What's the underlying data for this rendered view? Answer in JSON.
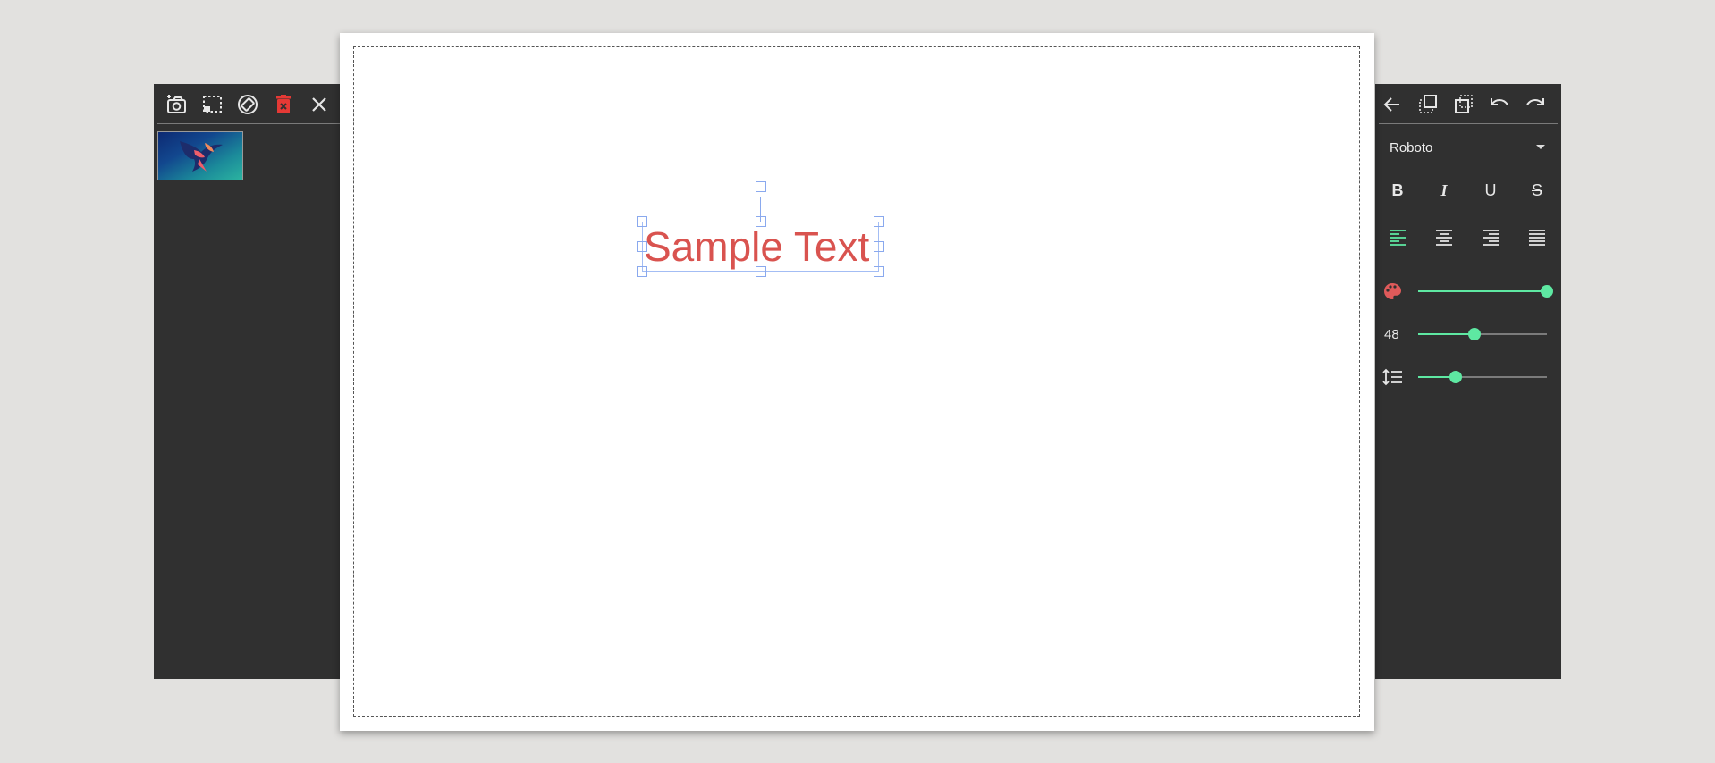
{
  "left_toolbar": {
    "buttons": [
      {
        "name": "add-photo-button",
        "icon": "camera-plus-icon"
      },
      {
        "name": "select-area-button",
        "icon": "dashed-select-icon"
      },
      {
        "name": "rotate-button",
        "icon": "rotate-icon"
      },
      {
        "name": "delete-button",
        "icon": "trash-icon",
        "color": "#e53935"
      },
      {
        "name": "close-button",
        "icon": "close-icon"
      }
    ]
  },
  "thumbnails": [
    {
      "icon": "bird-artwork-thumbnail"
    }
  ],
  "canvas": {
    "text_object": {
      "text": "Sample Text",
      "color": "#d9534f"
    }
  },
  "right_toolbar": {
    "buttons": [
      {
        "name": "back-button",
        "icon": "arrow-left-icon"
      },
      {
        "name": "bring-forward-button",
        "icon": "bring-forward-icon"
      },
      {
        "name": "send-backward-button",
        "icon": "send-backward-icon"
      },
      {
        "name": "undo-button",
        "icon": "undo-icon"
      },
      {
        "name": "redo-button",
        "icon": "redo-icon"
      }
    ]
  },
  "text_panel": {
    "font_family": "Roboto",
    "format_buttons": [
      {
        "name": "bold",
        "label": "B"
      },
      {
        "name": "italic",
        "label": "I"
      },
      {
        "name": "underline",
        "label": "U"
      },
      {
        "name": "strikethrough",
        "label": "S"
      }
    ],
    "alignment": {
      "options": [
        "left",
        "center",
        "right",
        "justify"
      ],
      "selected": "left"
    },
    "color_slider": {
      "icon": "palette-icon",
      "icon_color": "#e05a5a",
      "value": 1.0
    },
    "size_slider": {
      "label": "48",
      "value": 0.44
    },
    "line_height_slider": {
      "icon": "line-height-icon",
      "value": 0.29
    }
  },
  "colors": {
    "accent": "#5ee8a2",
    "panel_bg": "#303030",
    "page_bg": "#e2e1df",
    "selection": "#8aa9ee"
  }
}
